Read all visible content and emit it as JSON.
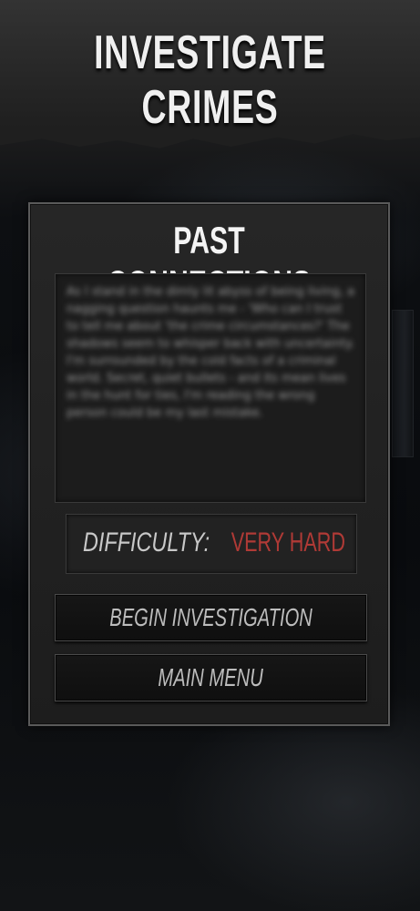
{
  "header": {
    "title": "INVESTIGATE CRIMES"
  },
  "mission": {
    "title": "PAST CONNECTIONS",
    "description": "As I stand in the dimly lit abyss of being living, a nagging question haunts me - 'Who can I trust to tell me about 'the crime circumstances?' The shadows seem to whisper back with uncertainty. I'm surrounded by the cold facts of a criminal world. Secret, quiet bullets - and its mean lives in the hunt for ties, I'm reading the wrong person could be my last mistake.",
    "difficulty_label": "DIFFICULTY:",
    "difficulty_value": "VERY HARD"
  },
  "buttons": {
    "begin_label": "BEGIN INVESTIGATION",
    "main_menu_label": "MAIN MENU"
  },
  "colors": {
    "difficulty_value": "#b03a36",
    "title_text": "#f0f0f0",
    "panel_border": "#5a5a5a"
  }
}
